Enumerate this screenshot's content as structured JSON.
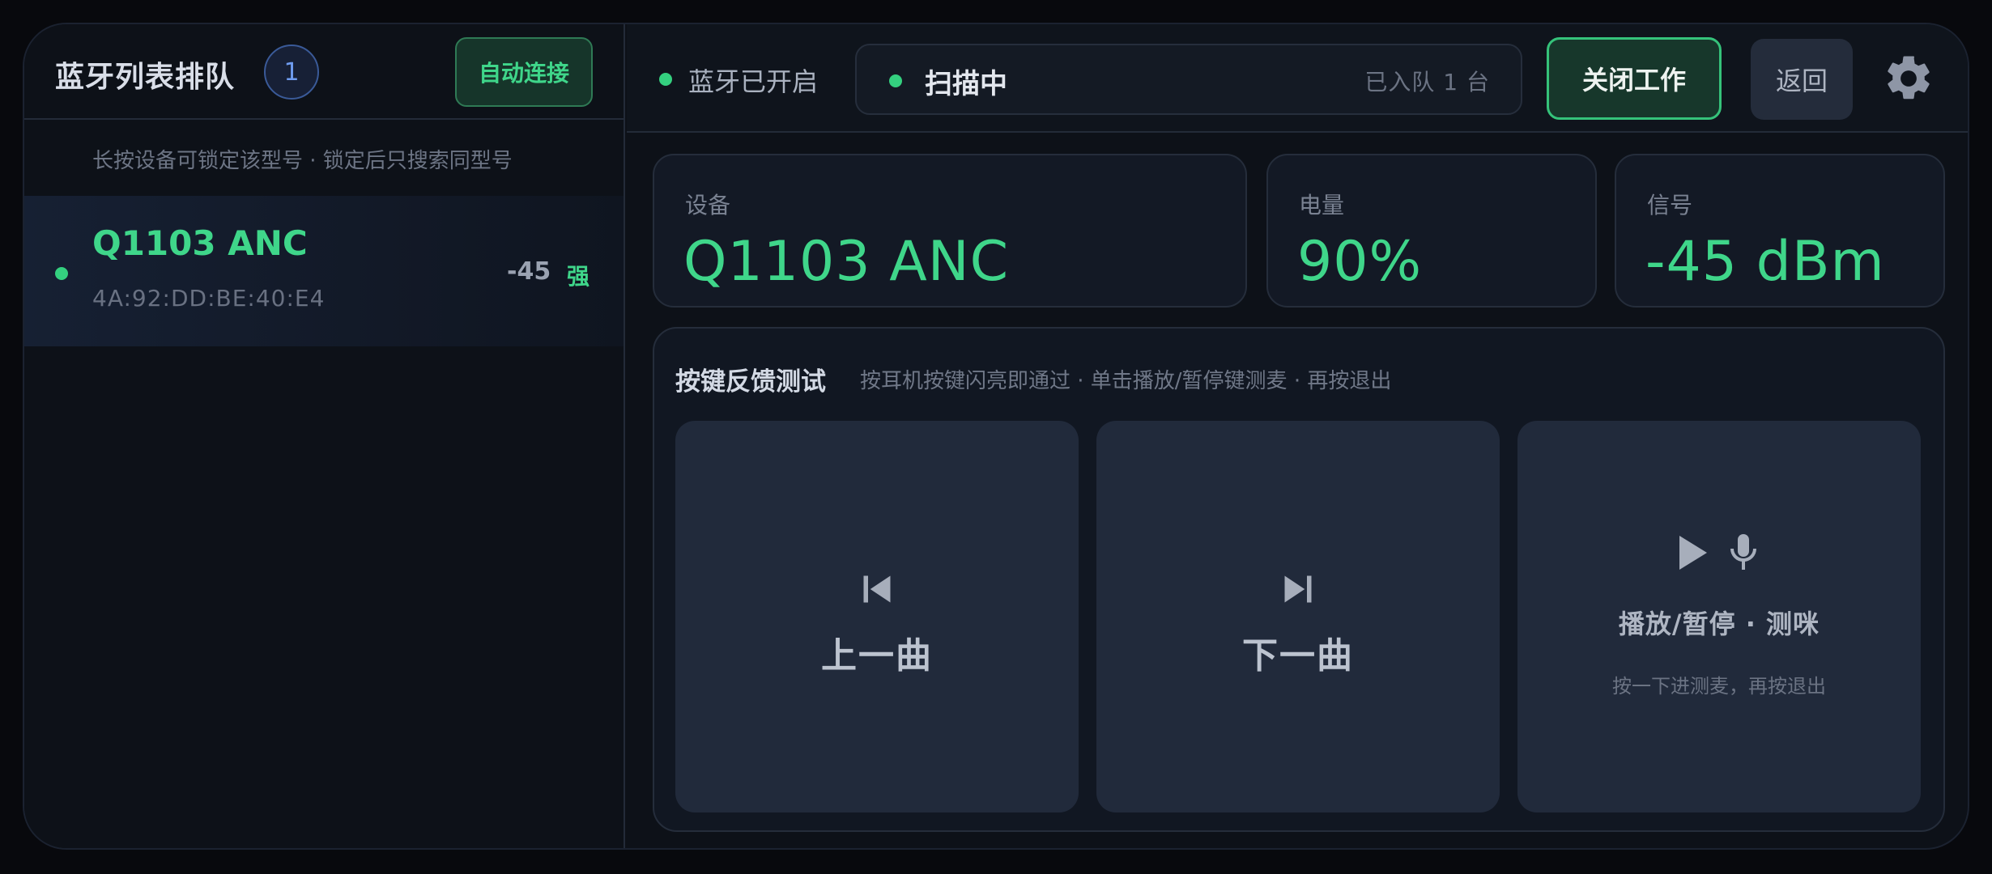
{
  "sidebar": {
    "title": "蓝牙列表排队",
    "count": "1",
    "auto_connect_label": "自动连接",
    "hint": "长按设备可锁定该型号 · 锁定后只搜索同型号",
    "devices": [
      {
        "name": "Q1103 ANC",
        "mac": "4A:92:DD:BE:40:E4",
        "rssi": "-45",
        "strength": "强"
      }
    ]
  },
  "topbar": {
    "bluetooth_status": "蓝牙已开启",
    "scan_status": "扫描中",
    "queue_status": "已入队 1 台",
    "close_label": "关闭工作",
    "back_label": "返回",
    "settings_icon": "gear-icon"
  },
  "stats": {
    "device": {
      "label": "设备",
      "value": "Q1103 ANC"
    },
    "battery": {
      "label": "电量",
      "value": "90%"
    },
    "signal": {
      "label": "信号",
      "value": "-45 dBm"
    }
  },
  "key_test": {
    "title": "按键反馈测试",
    "description": "按耳机按键闪亮即通过 · 单击播放/暂停键测麦 · 再按退出",
    "buttons": [
      {
        "icon": "skip-previous-icon",
        "label": "上一曲"
      },
      {
        "icon": "skip-next-icon",
        "label": "下一曲"
      },
      {
        "icons": [
          "play-icon",
          "microphone-icon"
        ],
        "label": "播放/暂停 · 测咪",
        "sub": "按一下进测麦，再按退出"
      }
    ]
  },
  "colors": {
    "accent_green": "#3fd68a",
    "badge_blue": "#6f9cf0",
    "background": "#0d1118",
    "card": "#131925",
    "key_button": "#212a3b"
  }
}
